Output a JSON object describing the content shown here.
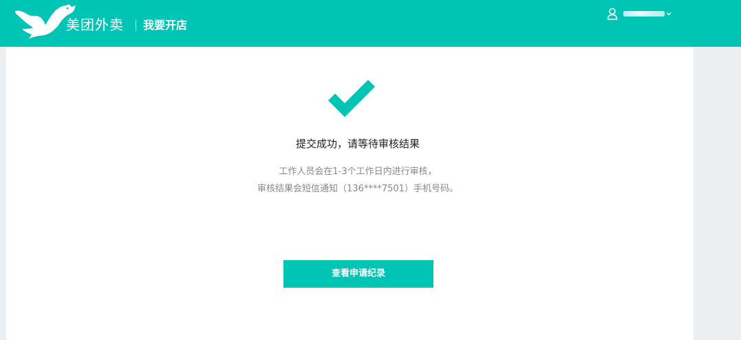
{
  "header": {
    "brand": "美团外卖",
    "subtitle": "我要开店",
    "logo_icon": "kangaroo-logo-icon",
    "user_icon": "user-icon",
    "menu_icon": "chevron-down-icon"
  },
  "main": {
    "status_icon": "checkmark-icon",
    "title": "提交成功，请等待审核结果",
    "description_line1": "工作人员会在1-3个工作日内进行审核，",
    "description_line2": "审核结果会短信通知（136****7501）手机号码。",
    "button_label": "查看申请纪录"
  },
  "colors": {
    "accent": "#00c4b4",
    "background": "#eceff2",
    "panel": "#ffffff"
  }
}
